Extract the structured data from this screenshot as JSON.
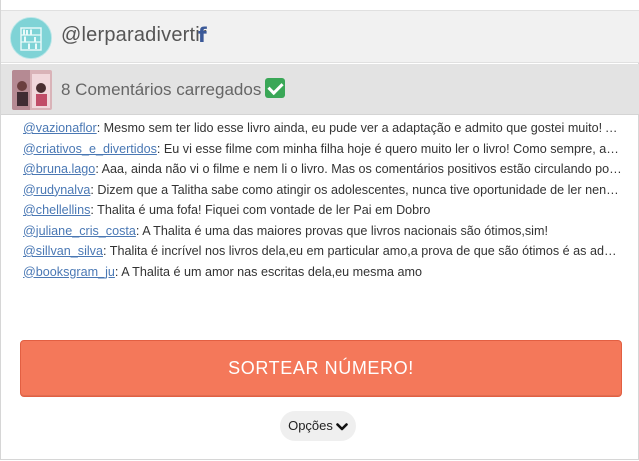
{
  "profile": {
    "handle": "@lerparadivertir",
    "avatar_icon": "bookshelf-avatar",
    "social_icon": "facebook-icon"
  },
  "post": {
    "count_label": "8 Comentários carregados",
    "status_icon": "check-mark-icon"
  },
  "comments": [
    {
      "user": "@vazionaflor",
      "text": ": Mesmo sem ter lido esse livro ainda, eu pude ver a adaptação e admito que gostei muito! Aqu..."
    },
    {
      "user": "@criativos_e_divertidos",
      "text": ": Eu vi esse filme com minha filha hoje é quero muito ler o livro! Como sempre, amo ..."
    },
    {
      "user": "@bruna.lago",
      "text": ": Aaa, ainda não vi o filme e nem li o livro. Mas os comentários positivos estão circulando por ai ..."
    },
    {
      "user": "@rudynalva",
      "text": ": Dizem que a Talitha sabe como atingir os adolescentes, nunca tive oportunidade de ler nenhu..."
    },
    {
      "user": "@chellellins",
      "text": ": Thalita é uma fofa! Fiquei com vontade de ler Pai em Dobro"
    },
    {
      "user": "@juliane_cris_costa",
      "text": ": A Thalita é uma das maiores provas que livros nacionais são ótimos,sim!"
    },
    {
      "user": "@sillvan_silva",
      "text": ": Thalita é incrível nos livros dela,eu em particular amo,a prova de que são ótimos é as adapta..."
    },
    {
      "user": "@booksgram_ju",
      "text": ": A Thalita é um amor nas escritas dela,eu mesma amo"
    }
  ],
  "actions": {
    "draw_label": "SORTEAR NÚMERO!",
    "options_label": "Opções"
  },
  "colors": {
    "accent": "#f4785a",
    "link": "#4a78b4",
    "facebook": "#3b5998",
    "check": "#3aa757"
  }
}
